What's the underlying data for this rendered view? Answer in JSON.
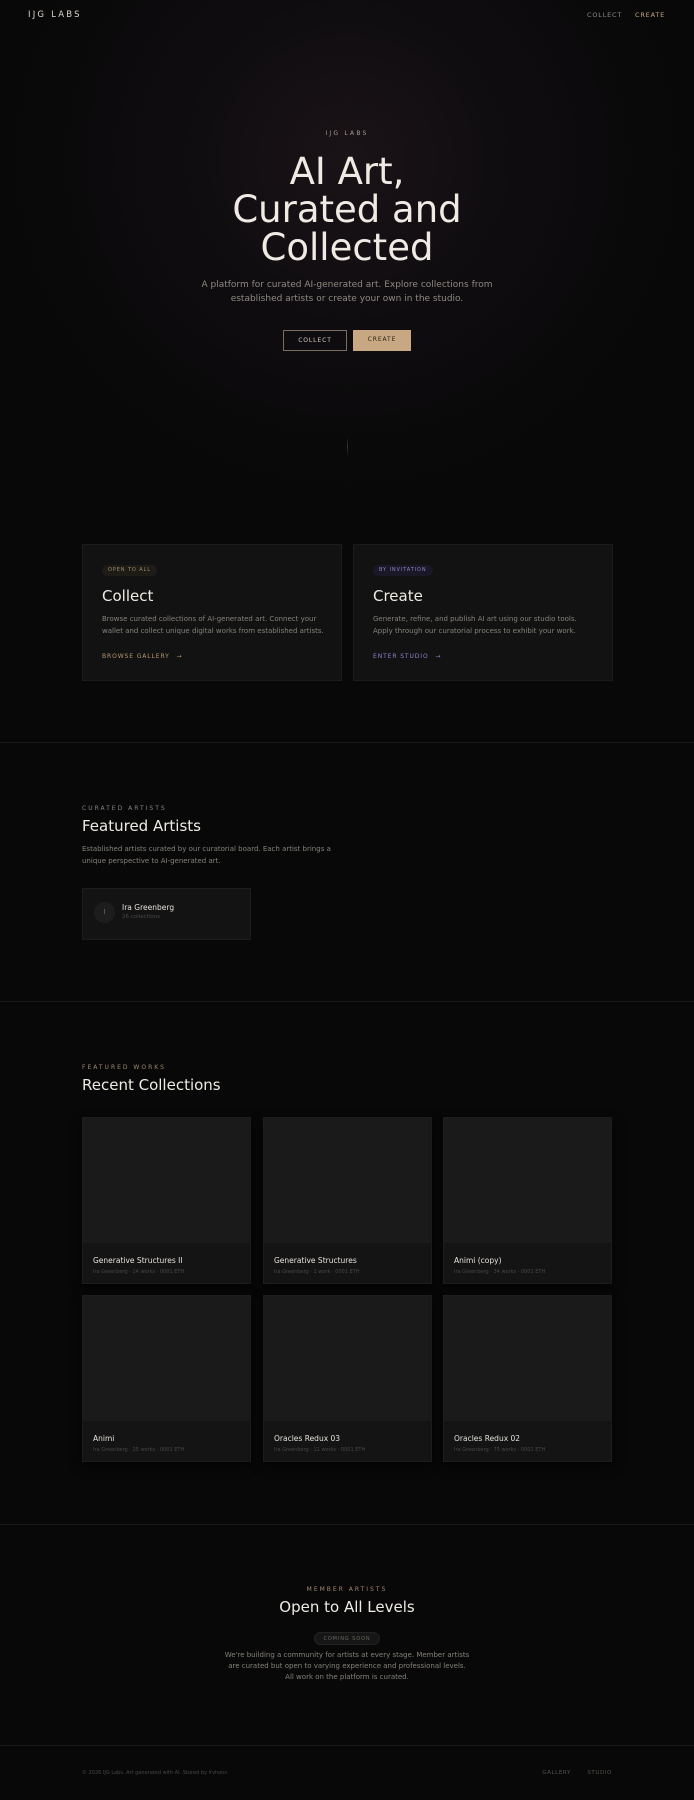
{
  "nav": {
    "logo": "IJG LABS",
    "collect": "COLLECT",
    "create": "CREATE"
  },
  "hero": {
    "eyebrow": "IJG LABS",
    "title_lines": [
      "AI Art,",
      "Curated and",
      "Collected"
    ],
    "subtitle": "A platform for curated AI-generated art. Explore collections from established artists or create your own in the studio.",
    "collect_button": "COLLECT",
    "create_button": "CREATE"
  },
  "paths": {
    "collect": {
      "badge": "OPEN TO ALL",
      "title": "Collect",
      "description": "Browse curated collections of AI-generated art. Connect your wallet and collect unique digital works from established artists.",
      "link": "BROWSE GALLERY",
      "arrow": "→"
    },
    "create": {
      "badge": "BY INVITATION",
      "title": "Create",
      "description": "Generate, refine, and publish AI art using our studio tools. Apply through our curatorial process to exhibit your work.",
      "link": "ENTER STUDIO",
      "arrow": "→"
    }
  },
  "artists": {
    "eyebrow": "CURATED ARTISTS",
    "title": "Featured Artists",
    "description": "Established artists curated by our curatorial board. Each artist brings a unique perspective to AI-generated art.",
    "items": [
      {
        "initial": "I",
        "name": "Ira Greenberg",
        "meta": "26 collections"
      }
    ]
  },
  "collections": {
    "eyebrow": "FEATURED WORKS",
    "title": "Recent Collections",
    "items": [
      {
        "name": "Generative Structures II",
        "artist": "Ira Greenberg",
        "works": "14 works",
        "price": "0001 ETH"
      },
      {
        "name": "Generative Structures",
        "artist": "Ira Greenberg",
        "works": "1 work",
        "price": "0001 ETH"
      },
      {
        "name": "Animi (copy)",
        "artist": "Ira Greenberg",
        "works": "34 works",
        "price": "0001 ETH"
      },
      {
        "name": "Animi",
        "artist": "Ira Greenberg",
        "works": "25 works",
        "price": "0001 ETH"
      },
      {
        "name": "Oracles Redux 03",
        "artist": "Ira Greenberg",
        "works": "11 works",
        "price": "0001 ETH"
      },
      {
        "name": "Oracles Redux 02",
        "artist": "Ira Greenberg",
        "works": "75 works",
        "price": "0001 ETH"
      }
    ]
  },
  "members": {
    "eyebrow": "MEMBER ARTISTS",
    "title": "Open to All Levels",
    "badge": "COMING SOON",
    "description": "We're building a community for artists at every stage. Member artists are curated but open to varying experience and professional levels. All work on the platform is curated."
  },
  "footer": {
    "copyright": "© 2026 IJG Labs. Art generated with AI. Stored by Irvhons",
    "gallery": "GALLERY",
    "studio": "STUDIO"
  },
  "colors": {
    "accent_gold": "#c8a882",
    "accent_purple": "#9285c8",
    "background": "#080808"
  }
}
